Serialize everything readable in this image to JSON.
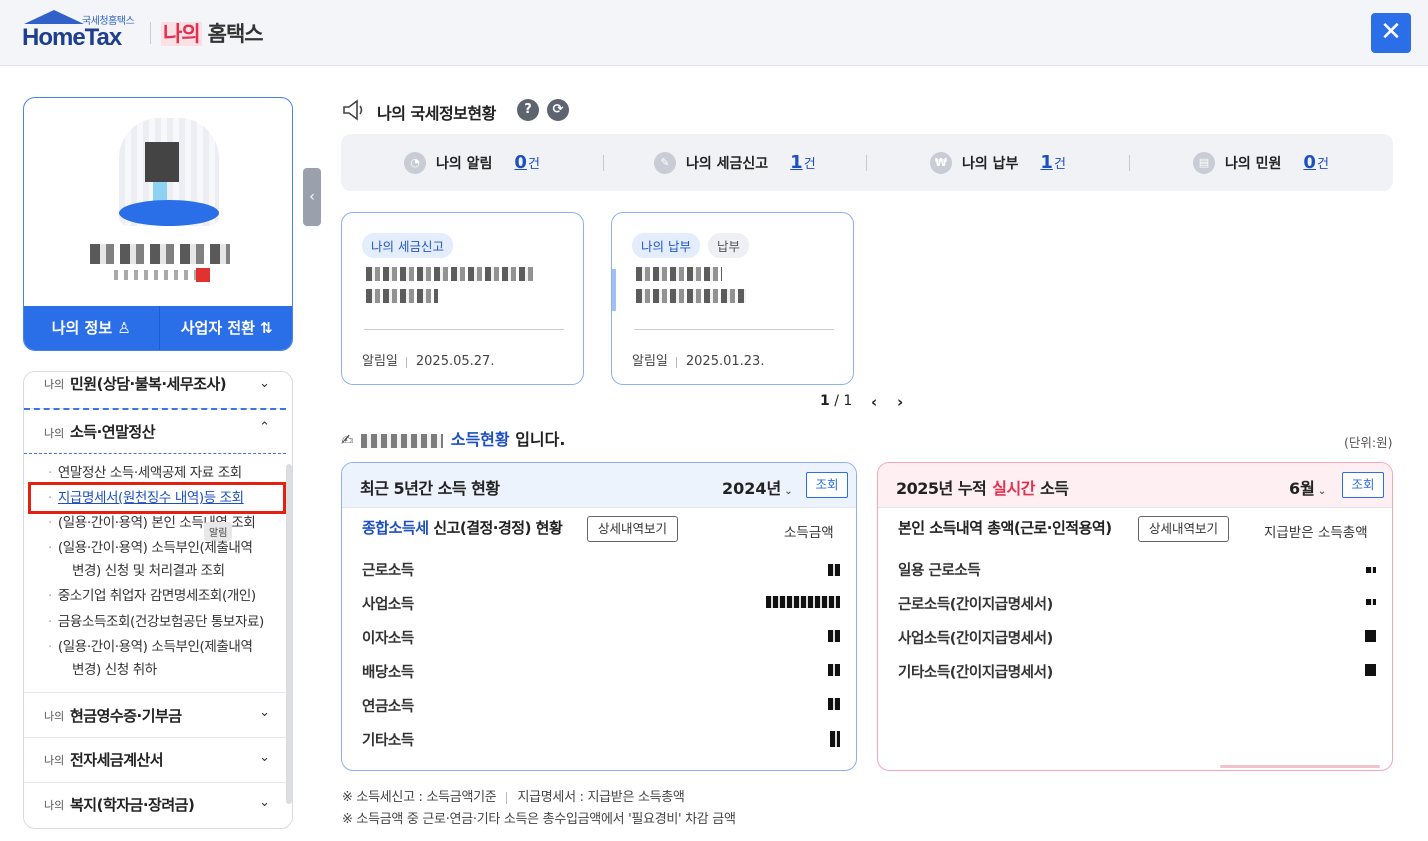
{
  "header": {
    "logo_small": "국세청홈택스",
    "logo_main": "HomeTax",
    "brand_my": "나의",
    "brand_rest": "홈택스",
    "close_icon": "close-icon"
  },
  "profile": {
    "my_info_button": "나의 정보 ♙",
    "business_switch_button": "사업자 전환 ⇅"
  },
  "menu": {
    "sections": [
      {
        "pre": "나의",
        "title": "민원(상담·불복·세무조사)"
      },
      {
        "pre": "나의",
        "title": "소득·연말정산"
      },
      {
        "pre": "나의",
        "title": "현금영수증·기부금"
      },
      {
        "pre": "나의",
        "title": "전자세금계산서"
      },
      {
        "pre": "나의",
        "title": "복지(학자금·장려금)"
      }
    ],
    "sub_items": [
      "연말정산 소득·세액공제 자료 조회",
      "지급명세서(원천징수 내역)등 조회",
      "(일용·간이·용역) 본인 소득내역 조회",
      "(일용·간이·용역) 소득부인(제출내역",
      "변경) 신청 및 처리결과 조회",
      "중소기업 취업자 감면명세조회(개인)",
      "금융소득조회(건강보험공단 통보자료)",
      "(일용·간이·용역) 소득부인(제출내역",
      "변경) 신청 취하"
    ],
    "tooltip": "알림"
  },
  "status": {
    "title": "나의 국세정보현황",
    "help_icon": "?",
    "refresh_icon": "⟳",
    "items": [
      {
        "label": "나의 알림",
        "count": "0",
        "unit": "건"
      },
      {
        "label": "나의 세금신고",
        "count": "1",
        "unit": "건"
      },
      {
        "label": "나의 납부",
        "count": "1",
        "unit": "건"
      },
      {
        "label": "나의 민원",
        "count": "0",
        "unit": "건"
      }
    ]
  },
  "cards": [
    {
      "chips": [
        "나의 세금신고"
      ],
      "date_label": "알림일",
      "date": "2025.05.27."
    },
    {
      "chips": [
        "나의 납부",
        "납부"
      ],
      "date_label": "알림일",
      "date": "2025.01.23."
    }
  ],
  "pager": {
    "current": "1",
    "total": "/ 1",
    "prev": "‹",
    "next": "›"
  },
  "income": {
    "title_suffix_blue": "소득현황",
    "title_suffix": " 입니다.",
    "unit": "(단위:원)"
  },
  "panel_left": {
    "title": "최근 5년간 소득 현황",
    "year": "2024년",
    "query": "조회",
    "subhead_blue": "종합소득세",
    "subhead": " 신고(결정·경정) 현황",
    "detail_button": "상세내역보기",
    "col_label": "소득금액",
    "rows": [
      "근로소득",
      "사업소득",
      "이자소득",
      "배당소득",
      "연금소득",
      "기타소득"
    ]
  },
  "panel_right": {
    "title_prefix": "2025년 누적",
    "title_red": "실시간",
    "title_suffix": "소득",
    "month": "6월",
    "query": "조회",
    "subhead": "본인 소득내역 총액(근로·인적용역)",
    "detail_button": "상세내역보기",
    "col_label": "지급받은 소득총액",
    "rows": [
      "일용 근로소득",
      "근로소득(간이지급명세서)",
      "사업소득(간이지급명세서)",
      "기타소득(간이지급명세서)"
    ]
  },
  "footnotes": {
    "line1_a": "※ 소득세신고 : 소득금액기준",
    "line1_b": "지급명세서 : 지급받은 소득총액",
    "line2": "※ 소득금액 중 근로·연금·기타 소득은 총수입금액에서 '필요경비' 차감 금액"
  }
}
